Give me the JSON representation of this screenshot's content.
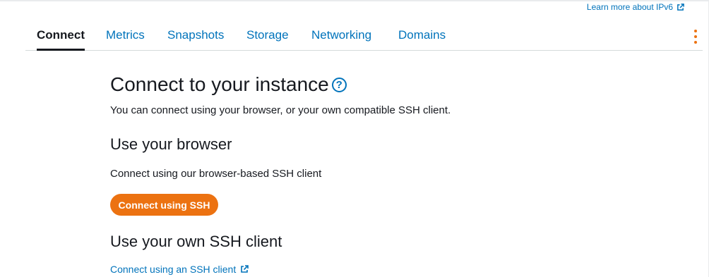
{
  "header": {
    "learn_more_link": "Learn more about IPv6",
    "external_icon": "external-link-icon"
  },
  "tabs": [
    {
      "label": "Connect",
      "active": true
    },
    {
      "label": "Metrics",
      "active": false
    },
    {
      "label": "Snapshots",
      "active": false
    },
    {
      "label": "Storage",
      "active": false
    },
    {
      "label": "Networking",
      "active": false
    },
    {
      "label": "Domains",
      "active": false
    }
  ],
  "menu_icon": "kebab-menu-icon",
  "main": {
    "title": "Connect to your instance",
    "help_icon": "?",
    "description": "You can connect using your browser, or your own compatible SSH client.",
    "browser_section": {
      "heading": "Use your browser",
      "text": "Connect using our browser-based SSH client",
      "button_label": "Connect using SSH"
    },
    "own_client_section": {
      "heading": "Use your own SSH client",
      "link_label": "Connect using an SSH client"
    }
  },
  "colors": {
    "accent": "#ec7211",
    "link": "#0073bb",
    "text": "#16191f"
  }
}
